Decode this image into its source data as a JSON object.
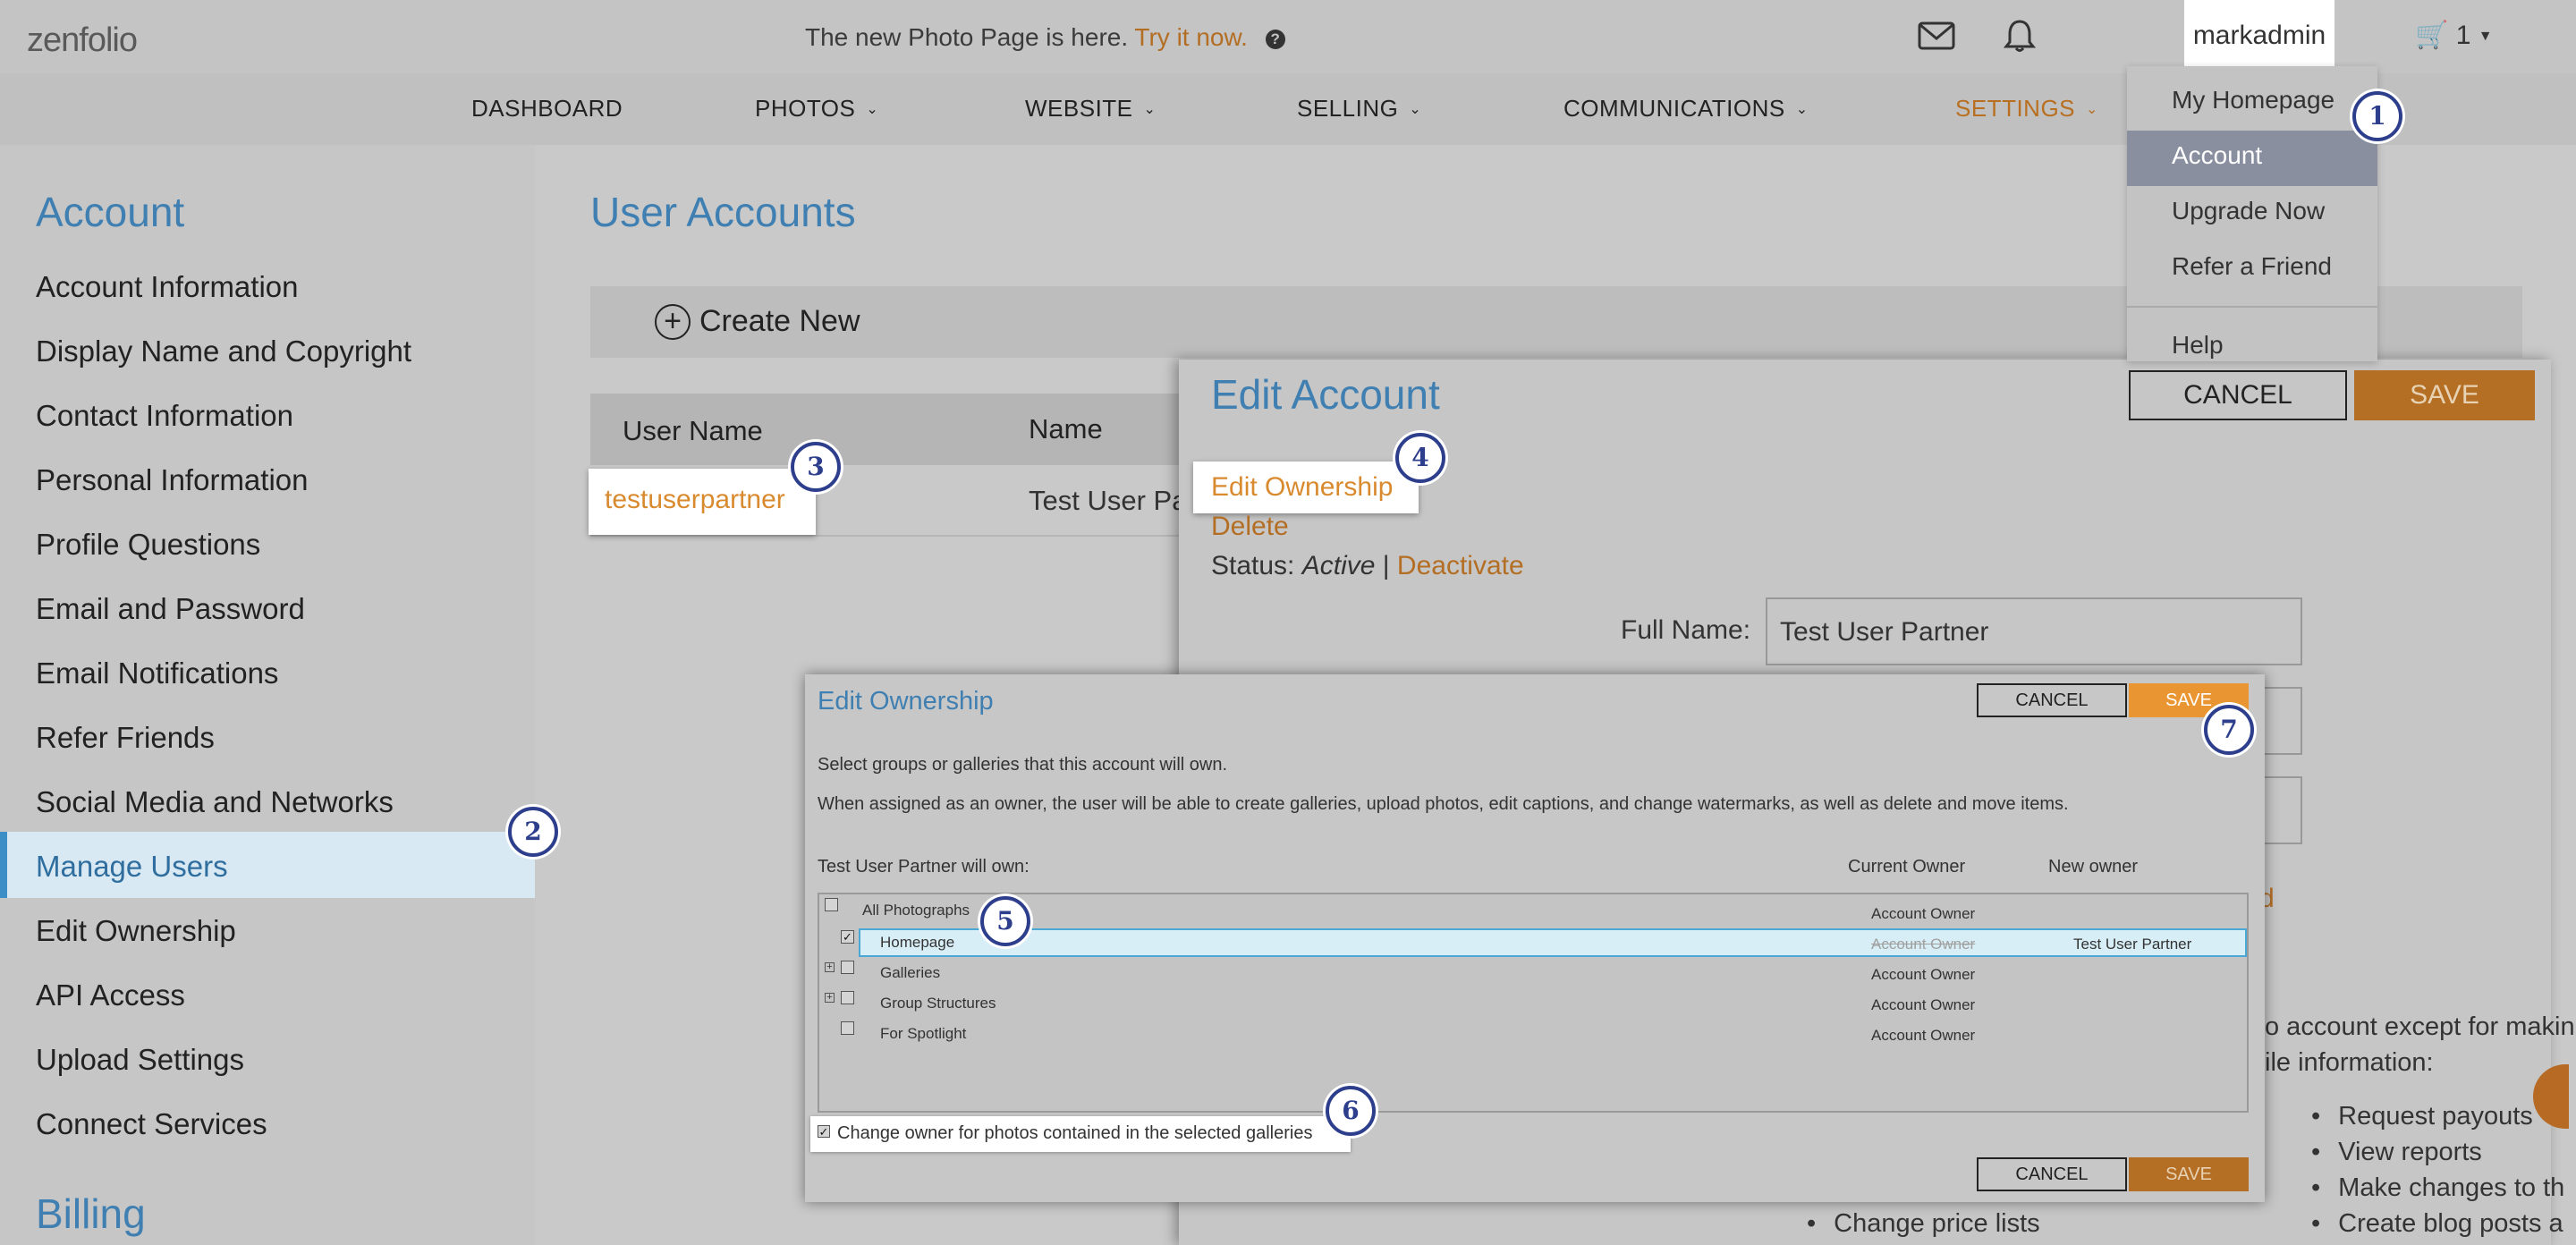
{
  "header": {
    "logo": "zenfolio",
    "announcement_text": "The new Photo Page is here.",
    "announcement_link": "Try it now.",
    "help_glyph": "?",
    "username": "markadmin",
    "cart_count": "1"
  },
  "nav": {
    "items": [
      {
        "label": "DASHBOARD"
      },
      {
        "label": "PHOTOS"
      },
      {
        "label": "WEBSITE"
      },
      {
        "label": "SELLING"
      },
      {
        "label": "COMMUNICATIONS"
      },
      {
        "label": "SETTINGS"
      }
    ]
  },
  "dropdown": {
    "items": [
      "My Homepage",
      "Account",
      "Upgrade Now",
      "Refer a Friend",
      "Help"
    ],
    "active": "Account"
  },
  "sidebar": {
    "heading": "Account",
    "items": [
      "Account Information",
      "Display Name and Copyright",
      "Contact Information",
      "Personal Information",
      "Profile Questions",
      "Email and Password",
      "Email Notifications",
      "Refer Friends",
      "Social Media and Networks",
      "Manage Users",
      "Edit Ownership",
      "API Access",
      "Upload Settings",
      "Connect Services"
    ],
    "active": "Manage Users",
    "heading2": "Billing"
  },
  "main": {
    "title": "User Accounts",
    "create_new": "Create New",
    "columns": [
      "User Name",
      "Name"
    ],
    "row": {
      "username": "testuserpartner",
      "name": "Test User Pa"
    }
  },
  "edit_account": {
    "title": "Edit Account",
    "cancel": "CANCEL",
    "save": "SAVE",
    "edit_ownership_link": "Edit Ownership",
    "delete_link": "Delete",
    "status_label": "Status:",
    "status_value": "Active",
    "status_sep": "|",
    "deactivate_link": "Deactivate",
    "fullname_label": "Full Name:",
    "fullname_value": "Test User Partner",
    "partial_orange": "d",
    "desc_line1": "o account except for makin",
    "desc_line2": "ile information:",
    "bullets_right": [
      "Request payouts",
      "View reports",
      "Make changes to th",
      "Create blog posts a"
    ],
    "bullets_left": [
      "Change price lists"
    ]
  },
  "edit_ownership": {
    "title": "Edit Ownership",
    "cancel": "CANCEL",
    "save": "SAVE",
    "intro1": "Select groups or galleries that this account will own.",
    "intro2": "When assigned as an owner, the user will be able to create galleries, upload photos, edit captions, and change watermarks, as well as delete and move items.",
    "will_own": "Test User Partner will own:",
    "col_current": "Current Owner",
    "col_new": "New owner",
    "tree": [
      {
        "label": "All Photographs",
        "current": "Account Owner",
        "checked": false
      },
      {
        "label": "Homepage",
        "current": "Account Owner",
        "new": "Test User Partner",
        "checked": true
      },
      {
        "label": "Galleries",
        "current": "Account Owner",
        "checked": false
      },
      {
        "label": "Group Structures",
        "current": "Account Owner",
        "checked": false
      },
      {
        "label": "For Spotlight",
        "current": "Account Owner",
        "checked": false
      }
    ],
    "change_owner_label": "Change owner for photos contained in the selected galleries",
    "change_owner_checked": true
  },
  "badges": [
    "1",
    "2",
    "3",
    "4",
    "5",
    "6",
    "7"
  ],
  "colors": {
    "accent_blue": "#3f7fb1",
    "accent_orange": "#d98a2e",
    "badge_navy": "#2d3e8c",
    "save_orange": "#b46f25"
  }
}
